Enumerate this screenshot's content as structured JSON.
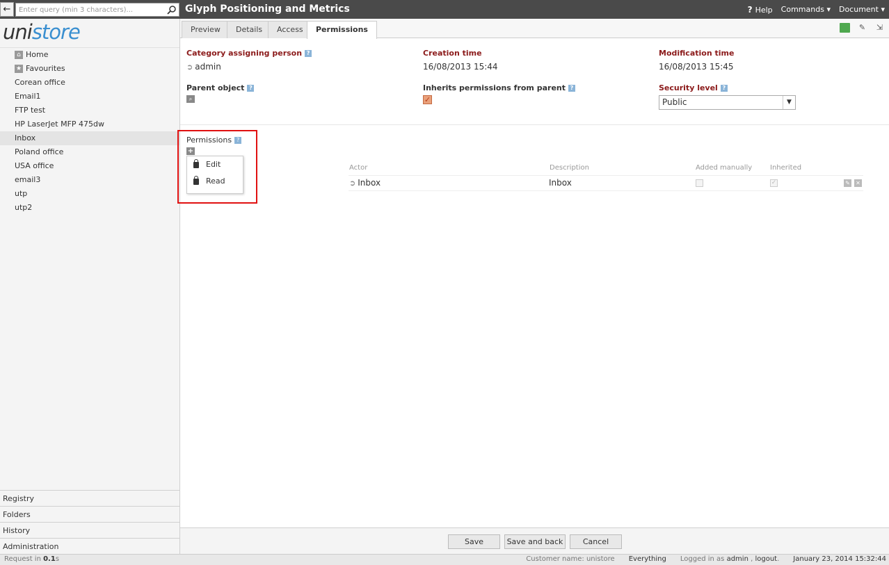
{
  "search": {
    "placeholder": "Enter query (min 3 characters)..."
  },
  "header": {
    "title": "Glyph Positioning and Metrics",
    "help_label": "Help",
    "commands_label": "Commands",
    "document_label": "Document"
  },
  "logo": {
    "part1": "uni",
    "part2": "store"
  },
  "sidebar": {
    "items": [
      {
        "label": "Home",
        "icon": "home-icon"
      },
      {
        "label": "Favourites",
        "icon": "star-icon"
      },
      {
        "label": "Corean office"
      },
      {
        "label": "Email1"
      },
      {
        "label": "FTP test"
      },
      {
        "label": "HP LaserJet MFP 475dw"
      },
      {
        "label": "Inbox",
        "active": true
      },
      {
        "label": "Poland office"
      },
      {
        "label": "USA office"
      },
      {
        "label": "email3"
      },
      {
        "label": "utp"
      },
      {
        "label": "utp2"
      }
    ],
    "bottom": [
      "Registry",
      "Folders",
      "History",
      "Administration"
    ]
  },
  "tabs": [
    "Preview",
    "Details",
    "Access",
    "Permissions"
  ],
  "fields": {
    "category_person": {
      "label": "Category assigning person",
      "value": "admin"
    },
    "creation_time": {
      "label": "Creation time",
      "value": "16/08/2013 15:44"
    },
    "modification_time": {
      "label": "Modification time",
      "value": "16/08/2013 15:45"
    },
    "parent_object": {
      "label": "Parent object"
    },
    "inherits": {
      "label": "Inherits permissions from parent",
      "checked": true
    },
    "security_level": {
      "label": "Security level",
      "value": "Public"
    }
  },
  "permissions": {
    "title": "Permissions",
    "columns": [
      "Actor",
      "Description",
      "Added manually",
      "Inherited"
    ],
    "rows": [
      {
        "actor": "Inbox",
        "description": "Inbox",
        "added_manually": false,
        "inherited": true
      }
    ],
    "menu": [
      "Edit",
      "Read"
    ]
  },
  "footer": {
    "save": "Save",
    "save_back": "Save and back",
    "cancel": "Cancel"
  },
  "status": {
    "request_prefix": "Request in ",
    "request_time": "0.1",
    "request_unit": "s",
    "customer_label": "Customer name: unistore",
    "everything": "Everything",
    "logged_in_label": "Logged in as",
    "user": "admin",
    "logout": "logout",
    "datetime": "January 23, 2014 15:32:44"
  },
  "colors": {
    "accent": "#3a8fd0",
    "label_red": "#8b1a1a",
    "highlight": "#e01010",
    "topbar": "#4a4a4a"
  }
}
